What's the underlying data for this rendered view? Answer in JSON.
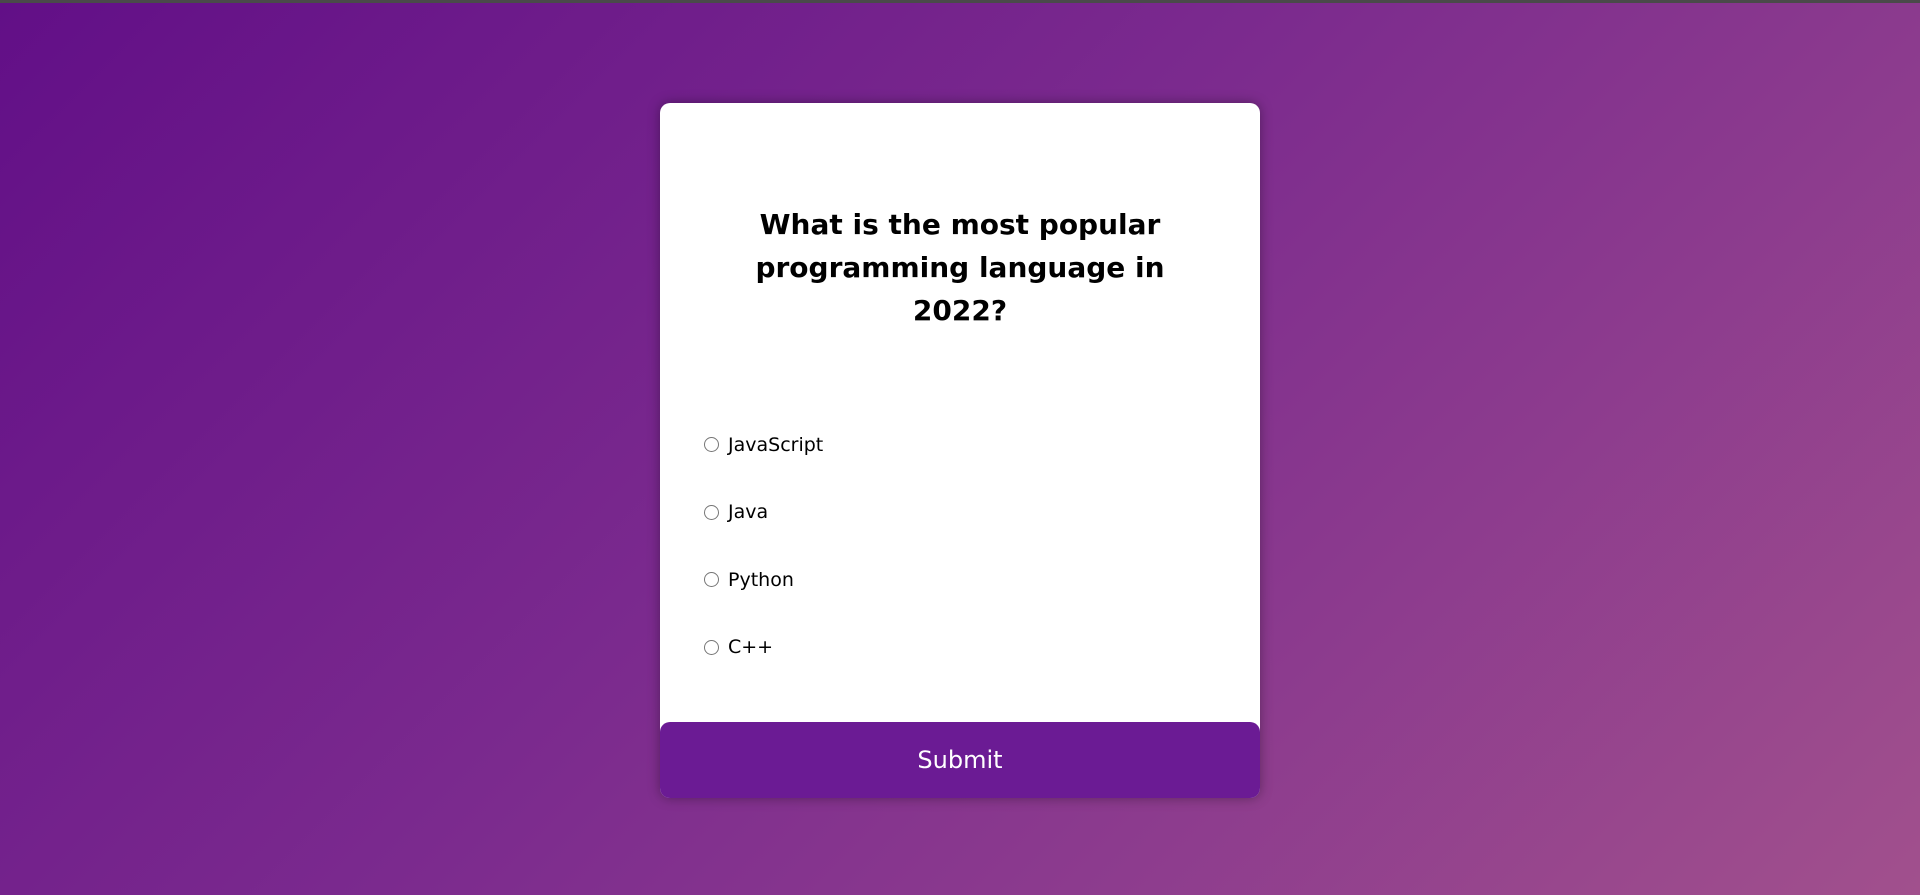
{
  "quiz": {
    "question": "What is the most popular programming language in 2022?",
    "answers": [
      {
        "label": "JavaScript"
      },
      {
        "label": "Java"
      },
      {
        "label": "Python"
      },
      {
        "label": "C++"
      }
    ],
    "submit_label": "Submit"
  },
  "colors": {
    "background_start": "#620f87",
    "background_end": "#a1508d",
    "button": "#6b1b94",
    "card": "#ffffff"
  }
}
